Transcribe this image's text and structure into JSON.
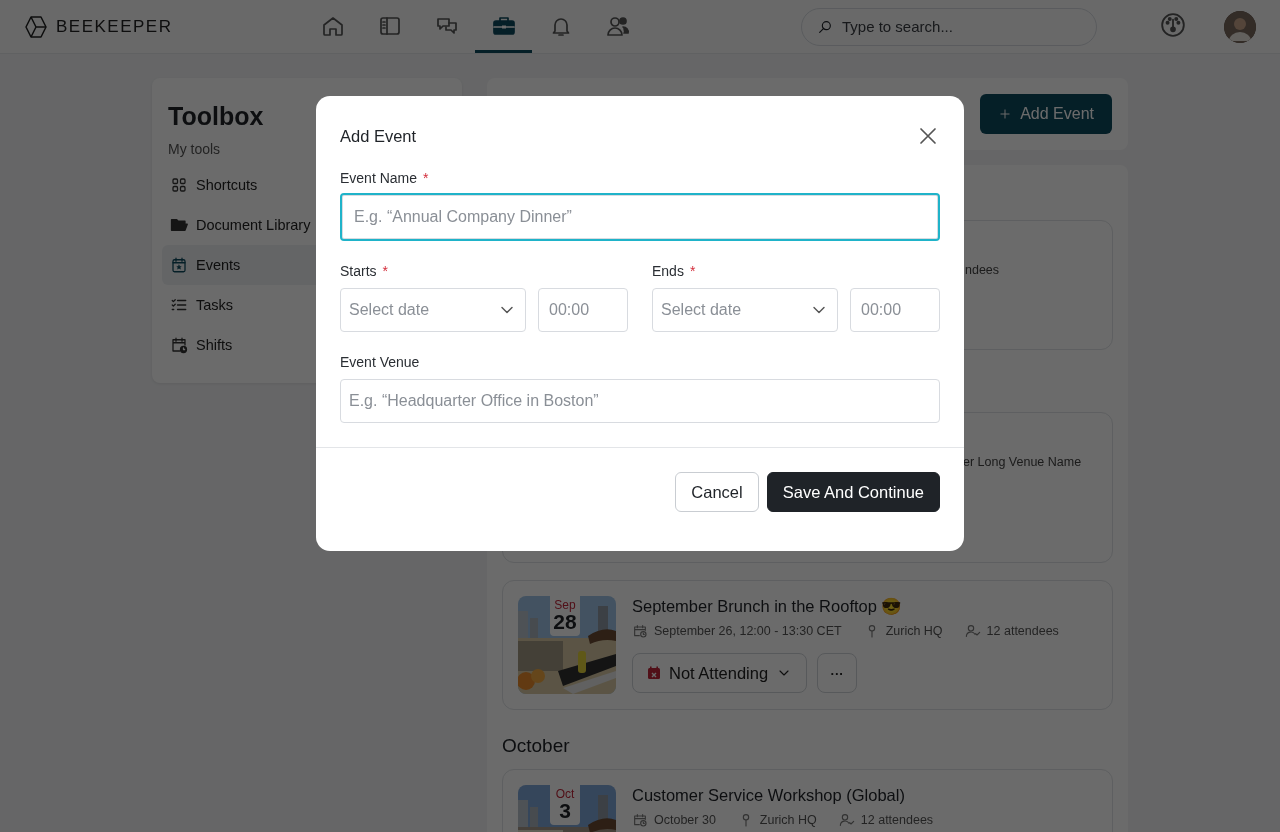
{
  "header": {
    "logo": "BEEKEEPER",
    "nav": [
      {
        "selected": false
      },
      {
        "selected": false
      },
      {
        "selected": false
      },
      {
        "selected": true
      },
      {
        "selected": false
      },
      {
        "selected": false
      }
    ],
    "search": {
      "placeholder": "Type to search..."
    }
  },
  "sidebar": {
    "title": "Toolbox",
    "subtitle": "My tools",
    "items": [
      {
        "label": "Shortcuts",
        "selected": false
      },
      {
        "label": "Document Library",
        "selected": false
      },
      {
        "label": "Events",
        "selected": true
      },
      {
        "label": "Tasks",
        "selected": false
      },
      {
        "label": "Shifts",
        "selected": false
      }
    ]
  },
  "main": {
    "add_button": "Add Event",
    "items": [
      {
        "kind": "partial_card",
        "text": "ndees"
      },
      {
        "kind": "partial_card",
        "text": "er Long Venue Name"
      },
      {
        "kind": "event",
        "month": "Sep",
        "day": "28",
        "title": "September Brunch in the Rooftop 😎",
        "date": "September 26, 12:00 - 13:30 CET",
        "venue": "Zurich HQ",
        "attendees": "12 attendees",
        "rsvp": "Not Attending",
        "more": "···"
      },
      {
        "kind": "heading",
        "text": "October"
      },
      {
        "kind": "event",
        "month": "Oct",
        "day": "3",
        "title": "Customer Service Workshop (Global)",
        "date": "October 30",
        "venue": "Zurich HQ",
        "attendees": "12 attendees"
      }
    ]
  },
  "modal": {
    "title": "Add Event",
    "name_field": {
      "label": "Event Name",
      "required_mark": "*",
      "placeholder": "E.g. “Annual Company Dinner”",
      "focused": true
    },
    "starts": {
      "label": "Starts",
      "required_mark": "*",
      "date_placeholder": "Select date",
      "time_placeholder": "00:00"
    },
    "ends": {
      "label": "Ends",
      "required_mark": "*",
      "date_placeholder": "Select date",
      "time_placeholder": "00:00"
    },
    "venue_field": {
      "label": "Event Venue",
      "placeholder": "E.g. “Headquarter Office in Boston”",
      "focused": false
    },
    "buttons": [
      {
        "label": "Cancel",
        "kind": "secondary"
      },
      {
        "label": "Save And Continue",
        "kind": "primary"
      }
    ]
  }
}
